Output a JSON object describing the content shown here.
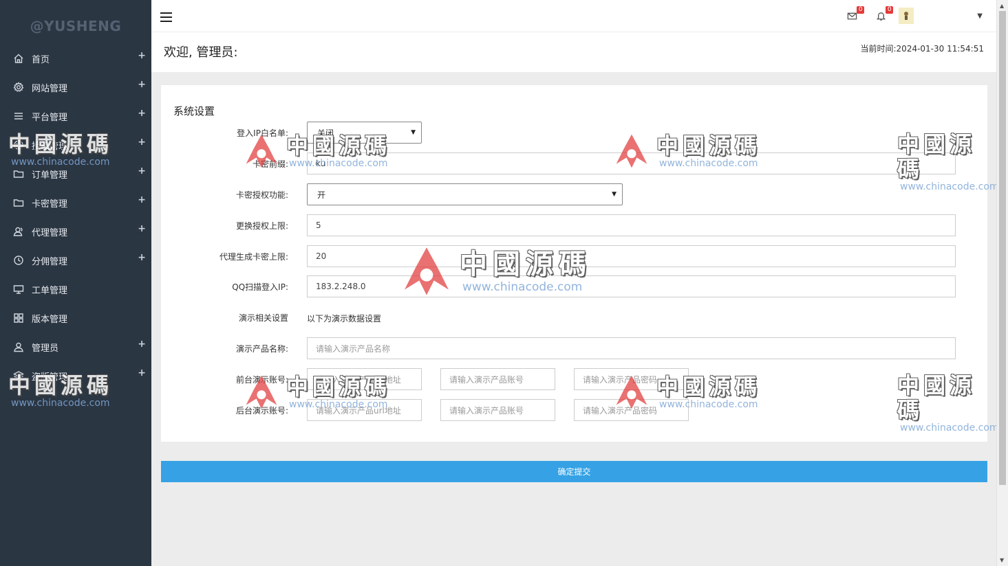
{
  "sidebar": {
    "brand": "@YUSHENG",
    "items": [
      {
        "label": "首页",
        "icon": "home-icon",
        "plus": "+"
      },
      {
        "label": "网站管理",
        "icon": "gear-icon",
        "plus": "+"
      },
      {
        "label": "平台管理",
        "icon": "list-icon",
        "plus": "+"
      },
      {
        "label": "授权管理",
        "icon": "aperture-icon",
        "plus": "+"
      },
      {
        "label": "订单管理",
        "icon": "folder-icon",
        "plus": "+"
      },
      {
        "label": "卡密管理",
        "icon": "folder-icon",
        "plus": "+"
      },
      {
        "label": "代理管理",
        "icon": "user-group-icon",
        "plus": "+"
      },
      {
        "label": "分佣管理",
        "icon": "clock-icon",
        "plus": "+"
      },
      {
        "label": "工单管理",
        "icon": "monitor-icon",
        "plus": ""
      },
      {
        "label": "版本管理",
        "icon": "grid-icon",
        "plus": ""
      },
      {
        "label": "管理员",
        "icon": "user-icon",
        "plus": "+"
      },
      {
        "label": "盗版管理",
        "icon": "layers-icon",
        "plus": "+"
      }
    ]
  },
  "header": {
    "mail_badge": "0",
    "bell_badge": "0",
    "welcome": "欢迎, 管理员:",
    "time": "当前时间:2024-01-30 11:54:51"
  },
  "form": {
    "title": "系统设置",
    "ip_whitelist": {
      "label": "登入IP白名单:",
      "value": "关闭"
    },
    "card_prefix": {
      "label": "卡密前缀:",
      "value": "ku"
    },
    "card_auth": {
      "label": "卡密授权功能:",
      "value": "开"
    },
    "change_limit": {
      "label": "更换授权上限:",
      "value": "5"
    },
    "agent_limit": {
      "label": "代理生成卡密上限:",
      "value": "20"
    },
    "qq_ip": {
      "label": "QQ扫描登入IP:",
      "value": "183.2.248.0"
    },
    "demo_settings": {
      "label": "演示相关设置",
      "value": "以下为演示数据设置"
    },
    "demo_name": {
      "label": "演示产品名称:",
      "placeholder": "请输入演示产品名称"
    },
    "front_demo": {
      "label": "前台演示账号:",
      "url_ph": "请输入演示产品url地址",
      "account_ph": "请输入演示产品账号",
      "password_ph": "请输入演示产品密码"
    },
    "back_demo": {
      "label": "后台演示账号:",
      "url_ph": "请输入演示产品url地址",
      "account_ph": "请输入演示产品账号",
      "password_ph": "请输入演示产品密码"
    },
    "submit": "确定提交"
  },
  "watermark": {
    "cn": "中國源碼",
    "url": "www.chinacode.com"
  },
  "colors": {
    "sidebar_bg": "#2b3643",
    "submit_bg": "#36a2e5",
    "badge": "#e53a3a"
  }
}
